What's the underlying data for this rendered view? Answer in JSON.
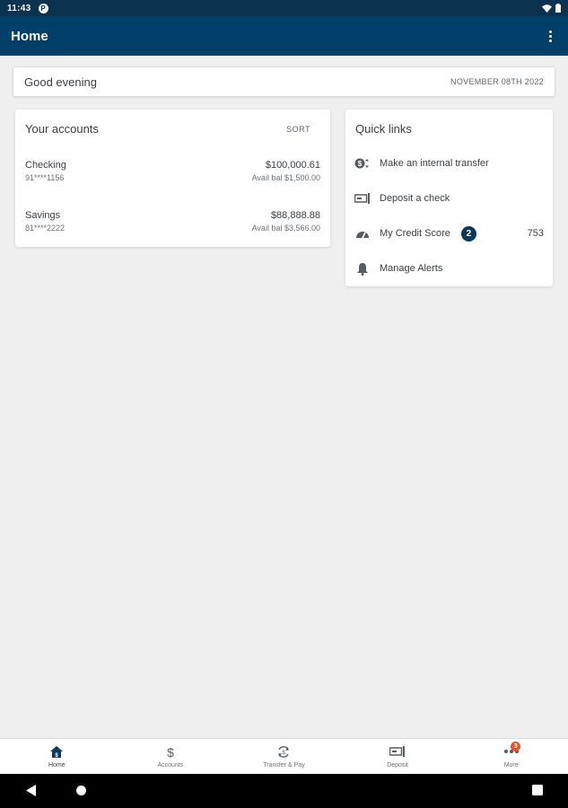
{
  "status_bar": {
    "time": "11:43",
    "app_icon_letter": "P"
  },
  "app_bar": {
    "title": "Home"
  },
  "greeting": {
    "text": "Good evening",
    "date": "NOVEMBER 08TH 2022"
  },
  "accounts": {
    "title": "Your accounts",
    "sort_label": "SORT",
    "items": [
      {
        "name": "Checking",
        "number": "91****1156",
        "balance": "$100,000.61",
        "available": "Avail bal $1,500.00"
      },
      {
        "name": "Savings",
        "number": "81****2222",
        "balance": "$88,888.88",
        "available": "Avail bal $3,566.00"
      }
    ]
  },
  "quick_links": {
    "title": "Quick links",
    "items": [
      {
        "label": "Make an internal transfer",
        "icon": "transfer-icon"
      },
      {
        "label": "Deposit a check",
        "icon": "deposit-check-icon"
      },
      {
        "label": "My Credit Score",
        "icon": "gauge-icon",
        "badge": "2",
        "value": "753"
      },
      {
        "label": "Manage Alerts",
        "icon": "bell-icon"
      }
    ]
  },
  "bottom_nav": {
    "items": [
      {
        "label": "Home",
        "icon": "home-icon",
        "active": true
      },
      {
        "label": "Accounts",
        "icon": "dollar-icon"
      },
      {
        "label": "Transfer & Pay",
        "icon": "transfer-pay-icon"
      },
      {
        "label": "Deposit",
        "icon": "deposit-icon"
      },
      {
        "label": "More",
        "icon": "more-icon",
        "badge": "3"
      }
    ]
  },
  "colors": {
    "app_bar": "#003f68",
    "status_bar": "#0b3350",
    "badge": "#0d3a5c",
    "notification": "#e5532b"
  }
}
